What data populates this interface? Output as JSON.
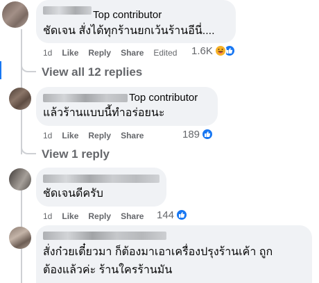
{
  "comments": [
    {
      "badge": "Top contributor",
      "lines": [
        "ชัดเจน สั่งได้ทุกร้านยกเว้นร้านอีนี่...."
      ],
      "time": "1d",
      "like": "Like",
      "reply": "Reply",
      "share": "Share",
      "edited": "Edited",
      "reaction_count": "1.6K",
      "view_replies": "View all 12 replies"
    },
    {
      "badge": "Top contributor",
      "lines": [
        "แล้วร้านแบบนี้ทำอร่อยนะ"
      ],
      "time": "1d",
      "like": "Like",
      "reply": "Reply",
      "share": "Share",
      "reaction_count": "189",
      "view_replies": "View 1 reply"
    },
    {
      "lines": [
        "ชัดเจนดีครับ"
      ],
      "time": "1d",
      "like": "Like",
      "reply": "Reply",
      "share": "Share",
      "reaction_count": "144"
    },
    {
      "lines": [
        "สั่งก๋วยเตี๋ยวมา ก็ต้องมาเอาเครื่องปรุงร้านเค้า ถูก",
        "ต้องแล้วค่ะ ร้านใครร้านมัน"
      ]
    }
  ],
  "colors": {
    "like_blue": "#1877f2",
    "haha_yellow": "#f7b125",
    "bubble_gray": "#f0f2f5",
    "meta_gray": "#65676b"
  }
}
